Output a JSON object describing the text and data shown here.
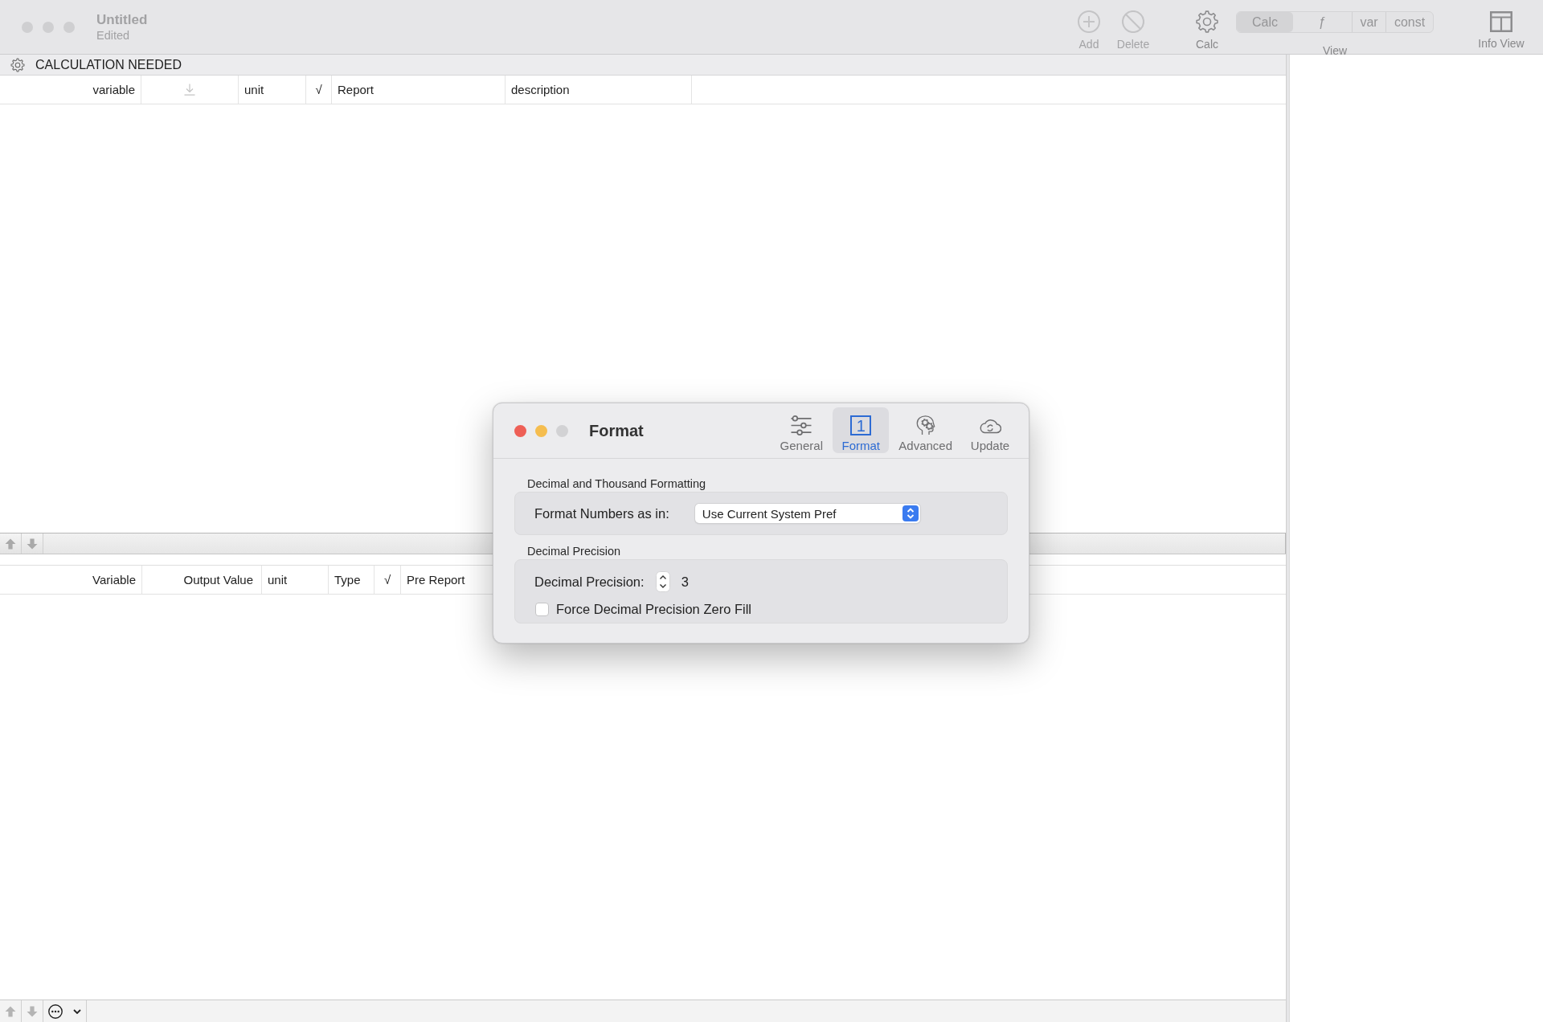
{
  "window": {
    "title": "Untitled",
    "subtitle": "Edited",
    "active": false
  },
  "toolbar": {
    "items": [
      {
        "kind": "add",
        "label": "Add",
        "disabled": true
      },
      {
        "kind": "delete",
        "label": "Delete",
        "disabled": true
      },
      {
        "kind": "calc",
        "label": "Calc",
        "disabled": false
      }
    ],
    "view": {
      "label": "View",
      "segments": [
        {
          "label": "Calc",
          "selected": true
        },
        {
          "label": "ƒ",
          "selected": false
        },
        {
          "label": "var",
          "selected": false
        },
        {
          "label": "const",
          "selected": false
        }
      ]
    },
    "info_view": {
      "label": "Info View"
    }
  },
  "status_bar": {
    "text": "CALCULATION NEEDED"
  },
  "input_table": {
    "columns": [
      {
        "kind": "text",
        "label": "variable"
      },
      {
        "kind": "download"
      },
      {
        "kind": "text",
        "label": "unit"
      },
      {
        "kind": "text",
        "label": "√"
      },
      {
        "kind": "text",
        "label": "Report"
      },
      {
        "kind": "text",
        "label": "description"
      }
    ]
  },
  "output_table": {
    "columns": [
      {
        "kind": "text",
        "label": "Variable"
      },
      {
        "kind": "text",
        "label": "Output Value"
      },
      {
        "kind": "text",
        "label": "unit"
      },
      {
        "kind": "text",
        "label": "Type"
      },
      {
        "kind": "text",
        "label": "√"
      },
      {
        "kind": "text",
        "label": "Pre Report"
      }
    ]
  },
  "dialog": {
    "title": "Format",
    "zoom_enabled": false,
    "tabs": [
      {
        "kind": "general",
        "label": "General",
        "selected": false
      },
      {
        "kind": "format",
        "label": "Format",
        "icon_text": "1",
        "selected": true
      },
      {
        "kind": "advanced",
        "label": "Advanced",
        "selected": false
      },
      {
        "kind": "update",
        "label": "Update",
        "selected": false
      }
    ],
    "sections": [
      {
        "heading": "Decimal and Thousand Formatting",
        "rows": [
          {
            "kind": "popup",
            "label": "Format Numbers as in:",
            "value": "Use Current System Pref"
          }
        ]
      },
      {
        "heading": "Decimal Precision",
        "rows": [
          {
            "kind": "stepper",
            "label": "Decimal Precision:",
            "value": "3"
          },
          {
            "kind": "checkbox",
            "label": "Force Decimal Precision Zero Fill",
            "checked": false
          }
        ]
      }
    ]
  }
}
